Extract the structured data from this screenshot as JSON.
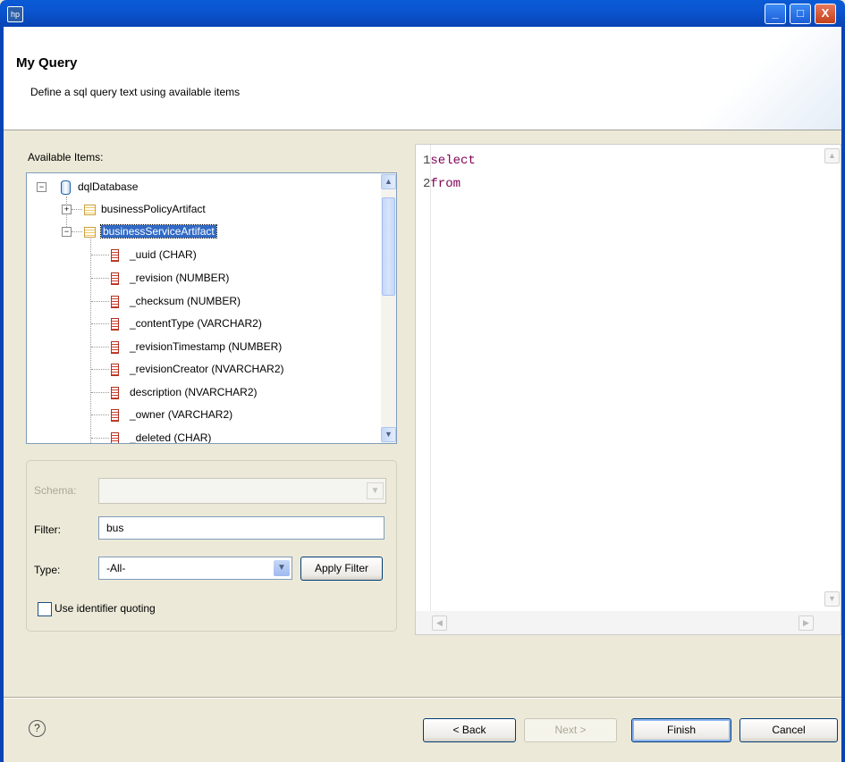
{
  "window": {
    "title": "",
    "minimize_glyph": "_",
    "maximize_glyph": "□",
    "close_glyph": "X"
  },
  "header": {
    "title": "My Query",
    "description": "Define a sql query text using available items"
  },
  "tree": {
    "label": "Available Items:",
    "root": "dqlDatabase",
    "tables": [
      "businessPolicyArtifact",
      "businessServiceArtifact"
    ],
    "selected_table": "businessServiceArtifact",
    "columns": [
      "_uuid (CHAR)",
      "_revision (NUMBER)",
      "_checksum (NUMBER)",
      "_contentType (VARCHAR2)",
      "_revisionTimestamp (NUMBER)",
      "_revisionCreator (NVARCHAR2)",
      "description (NVARCHAR2)",
      "_owner (VARCHAR2)",
      "_deleted (CHAR)"
    ]
  },
  "filters": {
    "schema_label": "Schema:",
    "schema_value": "",
    "filter_label": "Filter:",
    "filter_value": "bus",
    "type_label": "Type:",
    "type_value": "-All-",
    "apply_label": "Apply Filter",
    "quoting_label": "Use identifier quoting",
    "quoting_checked": false
  },
  "editor": {
    "lines": [
      {
        "num": "1",
        "text": "select"
      },
      {
        "num": "2",
        "text": "from"
      }
    ]
  },
  "footer": {
    "help_glyph": "?",
    "back_label": "< Back",
    "next_label": "Next >",
    "finish_label": "Finish",
    "cancel_label": "Cancel"
  },
  "icons": {
    "app": "hp-logo-icon",
    "database": "database-icon",
    "table": "table-icon",
    "column": "column-icon"
  }
}
